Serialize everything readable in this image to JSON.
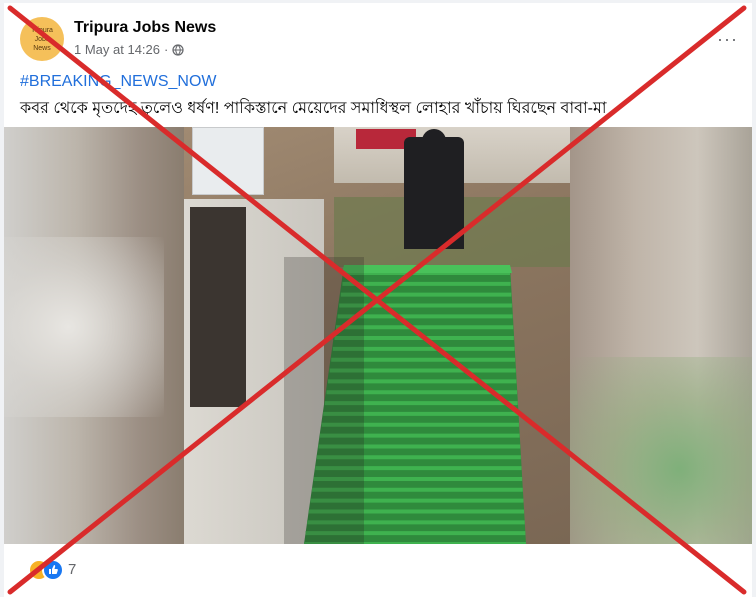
{
  "post": {
    "page_name": "Tripura Jobs News",
    "avatar_text": [
      "Tripura",
      "Jobs",
      "News"
    ],
    "timestamp": "1 May at 14:26",
    "separator": "·",
    "privacy_icon": "globe-icon",
    "more_label": "···",
    "hashtag": "#BREAKING_NEWS_NOW",
    "caption": "কবর থেকে মৃতদেহ তুলেও ধর্ষণ! পাকিস্তানে মেয়েদের সমাধিস্থল লোহার খাঁচায় ঘিরছেন বাবা-মা"
  },
  "photo": {
    "description_icon": "grave-photo"
  },
  "overlay": {
    "color": "#d92b2b"
  },
  "reactions": {
    "icons": [
      "care-icon",
      "like-icon"
    ],
    "count": "7"
  }
}
